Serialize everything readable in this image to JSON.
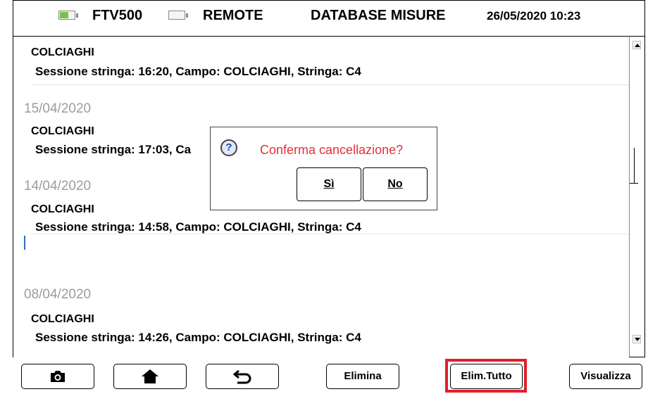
{
  "statusbar": {
    "device": "FTV500",
    "remote": "REMOTE",
    "title": "DATABASE MISURE",
    "datetime": "26/05/2020 10:23",
    "battery_color": "#7ac143"
  },
  "list": {
    "entries": [
      {
        "field": "COLCIAGHI",
        "session": "Sessione stringa: 16:20, Campo: COLCIAGHI, Stringa: C4"
      },
      {
        "date": "15/04/2020",
        "field": "COLCIAGHI",
        "session": "Sessione stringa: 17:03, Ca"
      },
      {
        "date": "14/04/2020",
        "field": "COLCIAGHI",
        "session": "Sessione stringa: 14:58, Campo: COLCIAGHI, Stringa: C4"
      },
      {
        "date": "08/04/2020",
        "field": "COLCIAGHI",
        "session": "Sessione stringa: 14:26, Campo: COLCIAGHI, Stringa: C4"
      }
    ]
  },
  "dialog": {
    "icon": "question-icon",
    "message": "Conferma cancellazione?",
    "yes_label": "Sì",
    "no_label": "No"
  },
  "toolbar": {
    "camera_icon": "camera-icon",
    "home_icon": "home-icon",
    "back_icon": "back-arrow-icon",
    "delete_label": "Elimina",
    "delete_all_label": "Elim.Tutto",
    "view_label": "Visualizza",
    "highlight_color": "#e0202a"
  }
}
